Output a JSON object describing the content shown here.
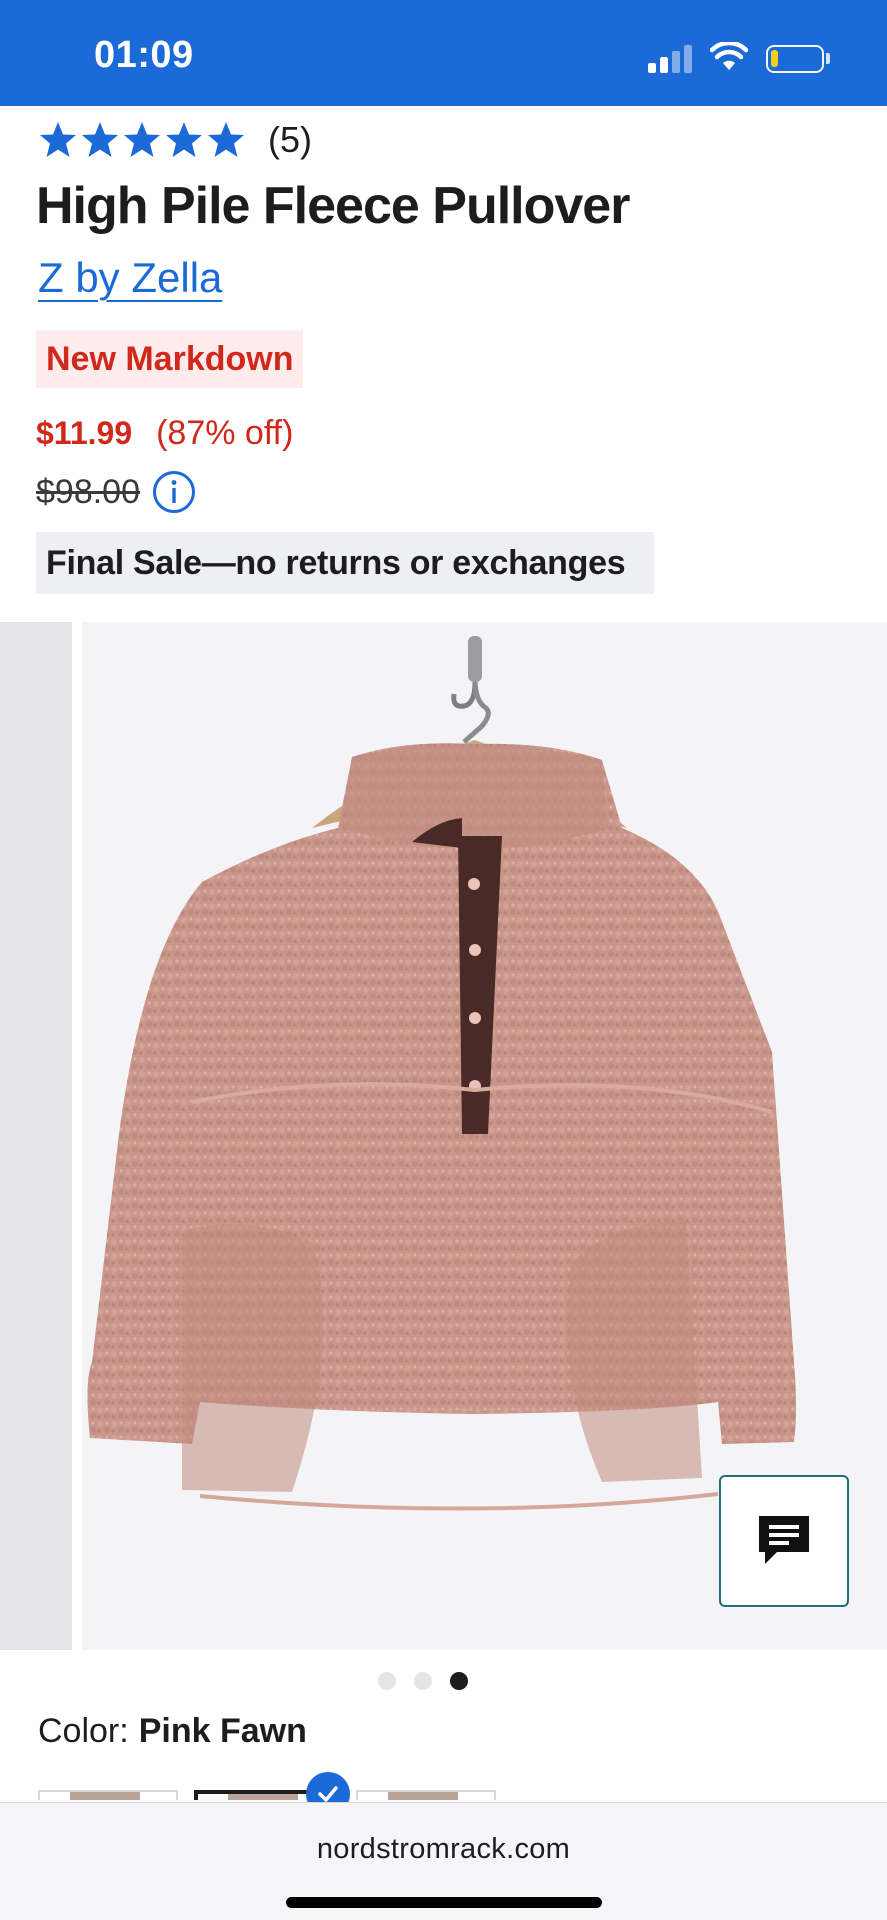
{
  "status_bar": {
    "time": "01:09",
    "signal_icon": "cellular-signal-icon",
    "wifi_icon": "wifi-icon",
    "battery_icon": "battery-low-icon",
    "battery_level": 0.15
  },
  "product": {
    "rating_value": 5,
    "rating_max": 5,
    "review_count": "(5)",
    "title": "High Pile Fleece Pullover",
    "brand": "Z by Zella",
    "badge": "New Markdown",
    "sale_price": "$11.99",
    "discount": "(87% off)",
    "original_price": "$98.00",
    "final_sale_note": "Final Sale—no returns or exchanges"
  },
  "gallery": {
    "image_count": 3,
    "active_index": 2,
    "chat_icon": "chat-bubble-icon"
  },
  "color": {
    "label": "Color:",
    "value": "Pink Fawn",
    "swatch_count": 3,
    "selected_swatch": 1
  },
  "browser": {
    "url": "nordstromrack.com"
  },
  "colors": {
    "accent": "#1b6ad8",
    "sale_red": "#d0281b",
    "badge_bg": "#fdeceb",
    "note_bg": "#eeeff2",
    "chat_border": "#1f6f7a"
  }
}
